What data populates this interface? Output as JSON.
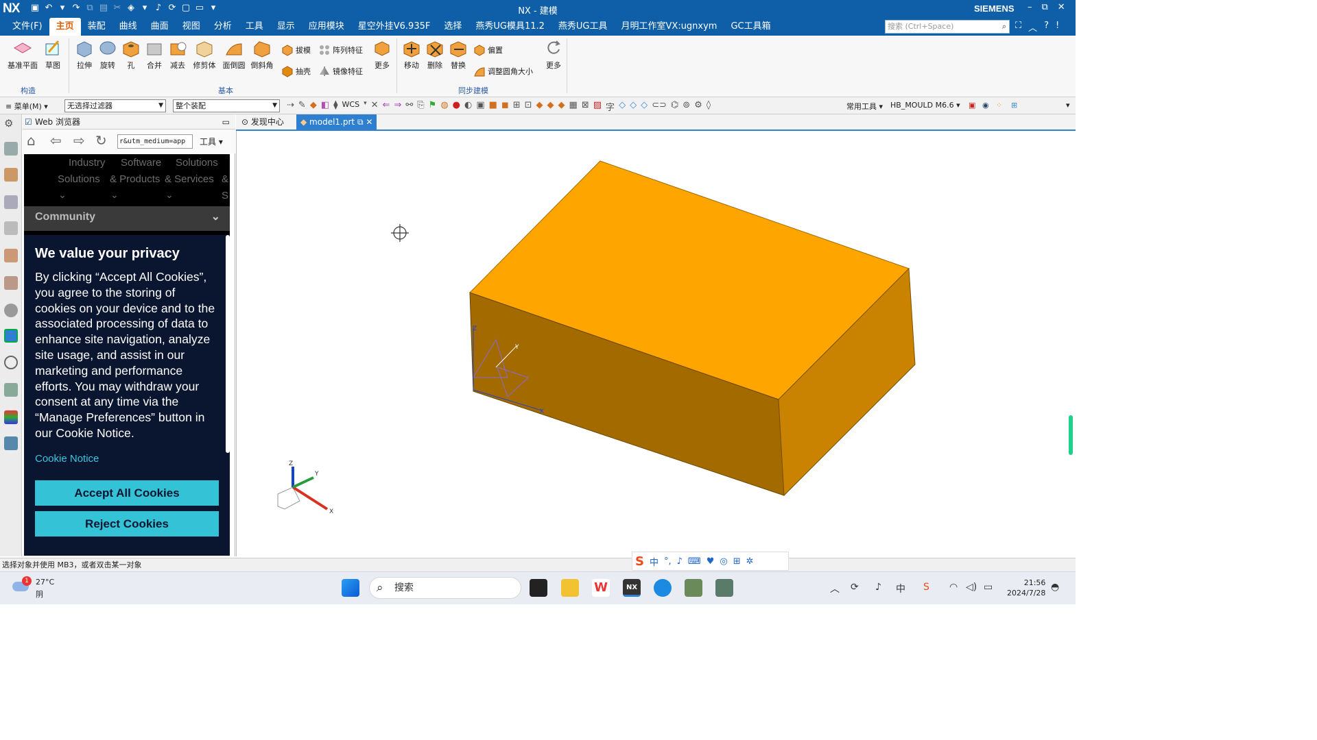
{
  "titlebar": {
    "logo": "NX",
    "title": "NX - 建模",
    "brand": "SIEMENS",
    "window_controls": [
      "–",
      "⧉",
      "✕"
    ]
  },
  "menubar": {
    "tabs": [
      "文件(F)",
      "主页",
      "装配",
      "曲线",
      "曲面",
      "视图",
      "分析",
      "工具",
      "显示",
      "应用模块",
      "星空外挂V6.935F",
      "选择",
      "燕秀UG模具11.2",
      "燕秀UG工具",
      "月明工作室VX:ugnxym",
      "GC工具箱"
    ],
    "active_tab": "主页",
    "search_placeholder": "搜索 (Ctrl+Space)"
  },
  "ribbon": {
    "construct": {
      "datum_plane": "基准平面",
      "sketch": "草图",
      "group_label": "构造"
    },
    "basic": {
      "extrude": "拉伸",
      "revolve": "旋转",
      "hole": "孔",
      "unite": "合并",
      "subtract": "减去",
      "trim_body": "修剪体",
      "face_blend": "面倒圆",
      "chamfer": "倒斜角",
      "draft": "拔模",
      "pattern_feature": "阵列特征",
      "shell": "抽壳",
      "mirror_feature": "镜像特征",
      "more": "更多",
      "group_label": "基本"
    },
    "sync": {
      "move": "移动",
      "delete": "删除",
      "replace": "替换",
      "offset": "偏置",
      "resize_blend": "调整圆角大小",
      "more": "更多",
      "group_label": "同步建模"
    }
  },
  "toolbar2": {
    "menu_label": "菜单(M)",
    "filter_value": "无选择过滤器",
    "assembly_value": "整个装配",
    "wcs_label": "WCS",
    "common_tools": "常用工具",
    "hb_mould": "HB_MOULD M6.6"
  },
  "webpanel": {
    "title": "Web 浏览器",
    "url": "r&utm_medium=app",
    "tools_label": "工具",
    "nav_items": [
      [
        "Industry",
        "Solutions"
      ],
      [
        "Software",
        "& Products"
      ],
      [
        "Solutions",
        "& Services"
      ],
      [
        "",
        "&"
      ],
      [
        "",
        "S"
      ]
    ],
    "community": "Community",
    "cookie": {
      "heading": "We value your privacy",
      "body": "By clicking “Accept All Cookies”, you agree to the storing of cookies on your device and to the associated processing of data to enhance site navigation, analyze site usage, and assist in our marketing and performance efforts. You may withdraw your consent at any time via the “Manage Preferences” button in our Cookie Notice.",
      "notice_link": "Cookie Notice",
      "accept_button": "Accept All Cookies",
      "reject_button": "Reject Cookies"
    }
  },
  "document_tabs": [
    {
      "label": "发现中心",
      "active": false
    },
    {
      "label": "model1.prt",
      "active": true
    }
  ],
  "viewport": {
    "model": "box",
    "model_color": "#ffa500",
    "axis_labels": {
      "x": "X",
      "y": "Y",
      "z": "Z"
    }
  },
  "statusbar": {
    "text": "选择对象并使用 MB3，或者双击某一对象"
  },
  "ime": {
    "mode": "中",
    "punct": "°,"
  },
  "taskbar": {
    "weather_temp": "27°C",
    "weather_cond": "阴",
    "weather_badge": "1",
    "search_placeholder": "搜索",
    "time": "21:56",
    "date": "2024/7/28"
  },
  "colors": {
    "titlebar": "#0f5fa8",
    "accent": "#2f7fd1",
    "cookie_bg": "#0a1530",
    "cookie_button": "#33c2d6"
  }
}
